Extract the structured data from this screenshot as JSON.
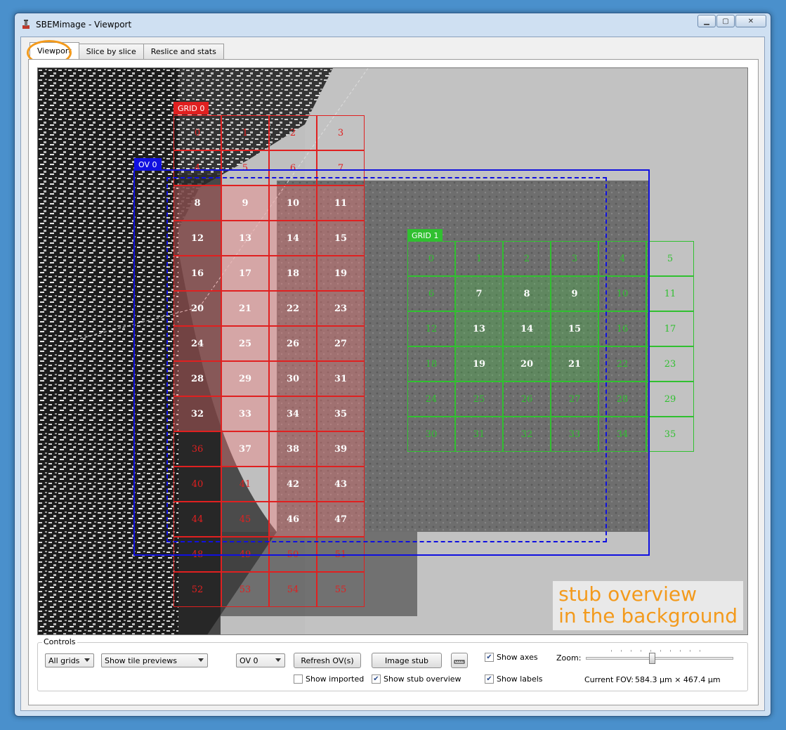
{
  "window": {
    "title": "SBEMimage - Viewport"
  },
  "tabs": [
    {
      "label": "Viewport"
    },
    {
      "label": "Slice by slice"
    },
    {
      "label": "Reslice and stats"
    }
  ],
  "viewport": {
    "grid0": {
      "label": "GRID 0",
      "color": "#e02020",
      "tiles": [
        "0",
        "1",
        "2",
        "3",
        "4",
        "5",
        "6",
        "7",
        "8",
        "9",
        "10",
        "11",
        "12",
        "13",
        "14",
        "15",
        "16",
        "17",
        "18",
        "19",
        "20",
        "21",
        "22",
        "23",
        "24",
        "25",
        "26",
        "27",
        "28",
        "29",
        "30",
        "31",
        "32",
        "33",
        "34",
        "35",
        "36",
        "37",
        "38",
        "39",
        "40",
        "41",
        "42",
        "43",
        "44",
        "45",
        "46",
        "47",
        "48",
        "49",
        "50",
        "51",
        "52",
        "53",
        "54",
        "55"
      ]
    },
    "grid1": {
      "label": "GRID 1",
      "color": "#30c030",
      "tiles": [
        "0",
        "1",
        "2",
        "3",
        "4",
        "5",
        "6",
        "7",
        "8",
        "9",
        "10",
        "11",
        "12",
        "13",
        "14",
        "15",
        "16",
        "17",
        "18",
        "19",
        "20",
        "21",
        "22",
        "23",
        "24",
        "25",
        "26",
        "27",
        "28",
        "29",
        "30",
        "31",
        "32",
        "33",
        "34",
        "35"
      ]
    },
    "ov0": {
      "label": "OV 0",
      "color": "#1010e0"
    },
    "annotation": {
      "line1": "stub overview",
      "line2": "in the background"
    }
  },
  "controls": {
    "group_label": "Controls",
    "grid_select": "All grids",
    "preview_select": "Show tile previews",
    "ov_select": "OV 0",
    "refresh_button": "Refresh OV(s)",
    "image_stub_button": "Image stub",
    "show_imported": "Show imported",
    "show_stub_overview": "Show stub overview",
    "show_axes": "Show axes",
    "show_labels": "Show labels",
    "zoom_label": "Zoom:",
    "fov_label": "Current FOV:",
    "fov_value": "584.3 µm × 467.4 µm",
    "show_axes_checked": true,
    "show_labels_checked": true,
    "show_stub_overview_checked": true,
    "show_imported_checked": false
  }
}
